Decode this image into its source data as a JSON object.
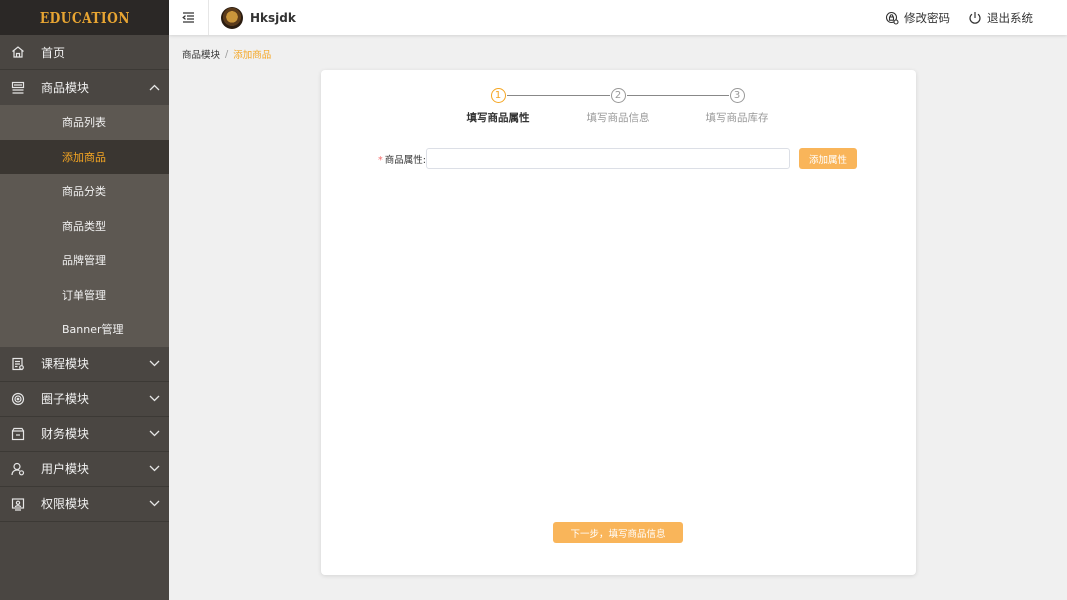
{
  "sidebar": {
    "logo": "EDUCATION",
    "items": [
      {
        "label": "首页"
      },
      {
        "label": "商品模块",
        "expanded": true,
        "children": [
          "商品列表",
          "添加商品",
          "商品分类",
          "商品类型",
          "品牌管理",
          "订单管理",
          "Banner管理"
        ],
        "active_child": "添加商品"
      },
      {
        "label": "课程模块"
      },
      {
        "label": "圈子模块"
      },
      {
        "label": "财务模块"
      },
      {
        "label": "用户模块"
      },
      {
        "label": "权限模块"
      }
    ]
  },
  "header": {
    "username": "Hksjdk",
    "change_password": "修改密码",
    "logout": "退出系统"
  },
  "breadcrumb": {
    "parent": "商品模块",
    "separator": "/",
    "current": "添加商品"
  },
  "steps": [
    {
      "number": "1",
      "label": "填写商品属性",
      "active": true
    },
    {
      "number": "2",
      "label": "填写商品信息",
      "active": false
    },
    {
      "number": "3",
      "label": "填写商品库存",
      "active": false
    }
  ],
  "form": {
    "required_mark": "*",
    "attribute_label": "商品属性:",
    "attribute_value": "",
    "add_button": "添加属性",
    "next_button": "下一步，填写商品信息"
  },
  "colors": {
    "accent": "#f5a623",
    "button": "#f9b55a",
    "sidebar_bg": "#4a4642",
    "submenu_bg": "#5d5852",
    "sub_active_bg": "#3a3631"
  }
}
